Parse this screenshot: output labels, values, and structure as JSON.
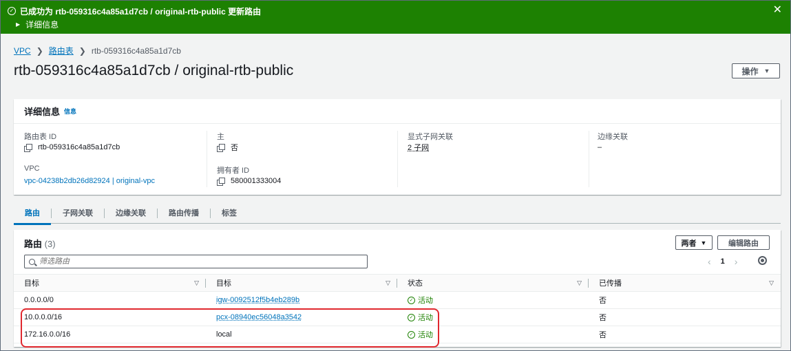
{
  "banner": {
    "message": "已成功为 rtb-059316c4a85a1d7cb / original-rtb-public 更新路由",
    "details_label": "详细信息",
    "close_glyph": "✕",
    "color": "#1d8102"
  },
  "breadcrumb": {
    "items": [
      "VPC",
      "路由表"
    ],
    "current": "rtb-059316c4a85a1d7cb"
  },
  "page_title": "rtb-059316c4a85a1d7cb / original-rtb-public",
  "actions_label": "操作",
  "details": {
    "title": "详细信息",
    "info": "信息",
    "route_table_id_label": "路由表 ID",
    "route_table_id": "rtb-059316c4a85a1d7cb",
    "vpc_label": "VPC",
    "vpc": "vpc-04238b2db26d82924 | original-vpc",
    "main_label": "主",
    "main": "否",
    "owner_label": "拥有者 ID",
    "owner": "580001333004",
    "subnet_assoc_label": "显式子网关联",
    "subnet_assoc": "2 子网",
    "edge_assoc_label": "边缘关联",
    "edge_assoc": "–"
  },
  "tabs": [
    "路由",
    "子网关联",
    "边缘关联",
    "路由传播",
    "标签"
  ],
  "routes": {
    "title": "路由",
    "count": "(3)",
    "both_label": "两者",
    "edit_label": "编辑路由",
    "filter_placeholder": "筛选路由",
    "page": "1",
    "columns": [
      "目标",
      "目标",
      "状态",
      "已传播"
    ],
    "rows": [
      {
        "destination": "0.0.0.0/0",
        "target": "igw-0092512f5b4eb289b",
        "status": "活动",
        "propagated": "否"
      },
      {
        "destination": "10.0.0.0/16",
        "target": "pcx-08940ec56048a3542",
        "status": "活动",
        "propagated": "否"
      },
      {
        "destination": "172.16.0.0/16",
        "target": "local",
        "status": "活动",
        "propagated": "否"
      }
    ]
  }
}
